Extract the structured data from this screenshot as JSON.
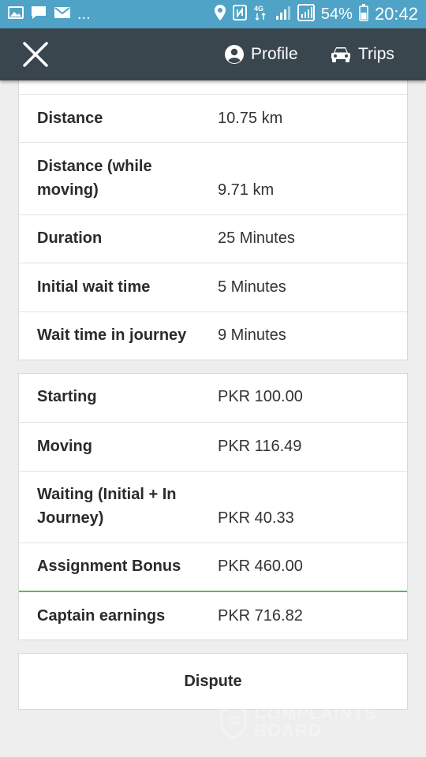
{
  "status_bar": {
    "left_icons": [
      "image-icon",
      "chat-icon",
      "mail-icon"
    ],
    "ellipsis": "...",
    "right_icons": [
      "location-icon",
      "nfc-icon",
      "4g-icon",
      "signal-icon",
      "signal-icon-2"
    ],
    "battery_percent": "54%",
    "time": "20:42"
  },
  "app_bar": {
    "profile_label": "Profile",
    "trips_label": "Trips"
  },
  "trip_details": [
    {
      "label": "Distance",
      "value": "10.75 km"
    },
    {
      "label": "Distance (while moving)",
      "value": "9.71 km"
    },
    {
      "label": "Duration",
      "value": "25 Minutes"
    },
    {
      "label": "Initial wait time",
      "value": "5 Minutes"
    },
    {
      "label": "Wait time in journey",
      "value": "9 Minutes"
    }
  ],
  "fare_breakdown": [
    {
      "label": "Starting",
      "value": "PKR 100.00"
    },
    {
      "label": "Moving",
      "value": "PKR 116.49"
    },
    {
      "label": "Waiting (Initial + In Journey)",
      "value": "PKR 40.33"
    },
    {
      "label": "Assignment Bonus",
      "value": "PKR 460.00"
    },
    {
      "label": "Captain earnings",
      "value": "PKR 716.82"
    }
  ],
  "dispute_label": "Dispute",
  "watermark": {
    "line1": "COMPLAINTS",
    "line2": "BOARD"
  },
  "colors": {
    "status_bar": "#4fa3c6",
    "app_bar": "#3a464e",
    "earnings_divider": "#5cb85c"
  }
}
